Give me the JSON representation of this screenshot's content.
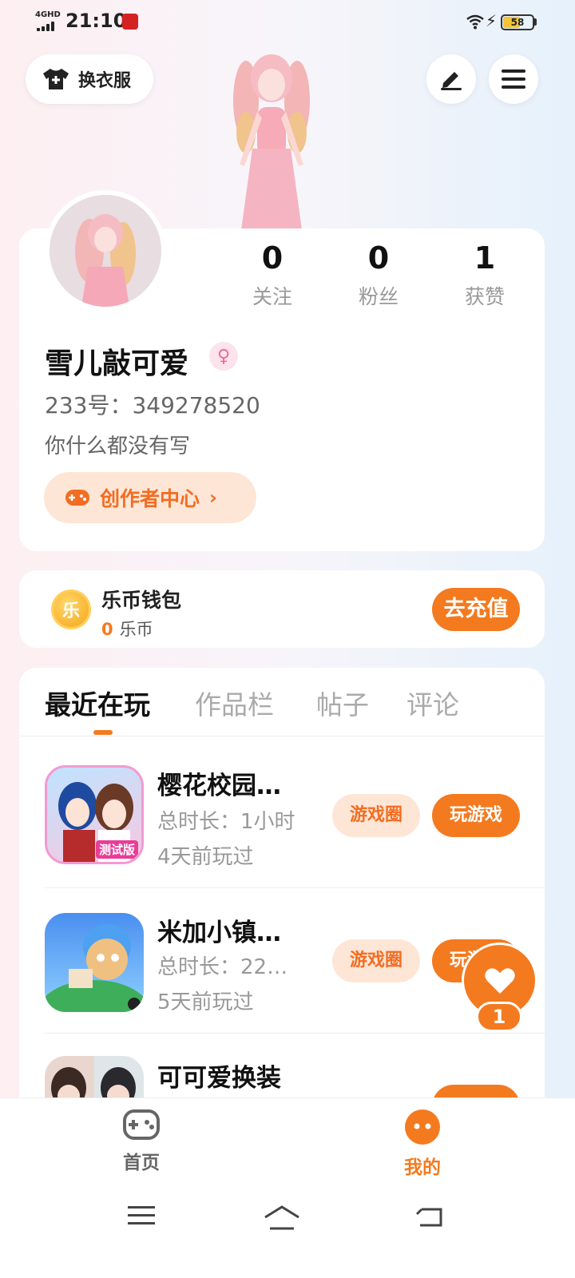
{
  "status_bar": {
    "network": "4GHD",
    "time": "21:10",
    "battery": "58",
    "battery_level": 0.58
  },
  "header": {
    "outfit_label": "换衣服",
    "edit_icon": "pencil-icon",
    "menu_icon": "hamburger-menu-icon"
  },
  "profile": {
    "stats": [
      {
        "value": "0",
        "label": "关注"
      },
      {
        "value": "0",
        "label": "粉丝"
      },
      {
        "value": "1",
        "label": "获赞"
      }
    ],
    "username": "雪儿敲可爱",
    "gender_symbol": "♀",
    "uid": "233号：349278520",
    "bio": "你什么都没有写",
    "creator_label": "创作者中心",
    "creator_chevron": "›"
  },
  "wallet": {
    "coin_glyph": "乐",
    "title": "乐币钱包",
    "amount": "0",
    "unit": "乐币",
    "recharge_label": "去充值"
  },
  "tabs": [
    {
      "label": "最近在玩",
      "active": true
    },
    {
      "label": "作品栏",
      "active": false
    },
    {
      "label": "帖子",
      "active": false
    },
    {
      "label": "评论",
      "active": false
    }
  ],
  "games": [
    {
      "name": "樱花校园…",
      "duration": "总时长：1小时",
      "last_played": "4天前玩过",
      "circle_label": "游戏圈",
      "play_label": "玩游戏",
      "badge": "测试版"
    },
    {
      "name": "米加小镇…",
      "duration": "总时长：22…",
      "last_played": "5天前玩过",
      "circle_label": "游戏圈",
      "play_label": "玩游戏"
    },
    {
      "name": "可可爱换装"
    }
  ],
  "fab": {
    "count": "1"
  },
  "bottom_nav": [
    {
      "label": "首页",
      "active": false
    },
    {
      "label": "我的",
      "active": true
    }
  ],
  "colors": {
    "accent": "#f47a1f",
    "accent_light": "#fde6d6"
  }
}
